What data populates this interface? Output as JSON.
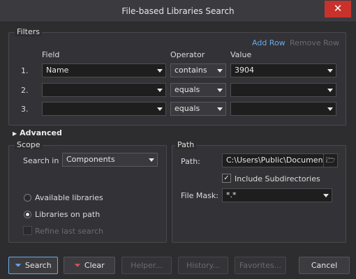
{
  "window": {
    "title": "File-based Libraries Search"
  },
  "filters": {
    "group_label": "Filters",
    "add_row": "Add Row",
    "remove_row": "Remove Row",
    "headers": {
      "field": "Field",
      "operator": "Operator",
      "value": "Value"
    },
    "rows": [
      {
        "index": "1.",
        "field": "Name",
        "operator": "contains",
        "value": "3904"
      },
      {
        "index": "2.",
        "field": "",
        "operator": "equals",
        "value": ""
      },
      {
        "index": "3.",
        "field": "",
        "operator": "equals",
        "value": ""
      }
    ]
  },
  "advanced": {
    "label": "Advanced"
  },
  "scope": {
    "group_label": "Scope",
    "search_in_label": "Search in",
    "search_in_value": "Components",
    "options": {
      "available": "Available libraries",
      "on_path": "Libraries on path",
      "refine": "Refine last search"
    },
    "selected": "on_path"
  },
  "path": {
    "group_label": "Path",
    "path_label": "Path:",
    "path_value": "C:\\Users\\Public\\Documents\\",
    "include_subdirs": "Include Subdirectories",
    "include_subdirs_checked": true,
    "file_mask_label": "File Mask:",
    "file_mask_value": "*.*"
  },
  "buttons": {
    "search": "Search",
    "clear": "Clear",
    "helper": "Helper...",
    "history": "History...",
    "favorites": "Favorites...",
    "cancel": "Cancel"
  },
  "icons": {
    "close": "close-icon",
    "advanced": "triangle-right-icon",
    "browse": "folder-open-icon",
    "search": "funnel-icon",
    "clear": "funnel-clear-icon"
  },
  "colors": {
    "accent": "#6aa8e8",
    "close": "#c8322b"
  }
}
